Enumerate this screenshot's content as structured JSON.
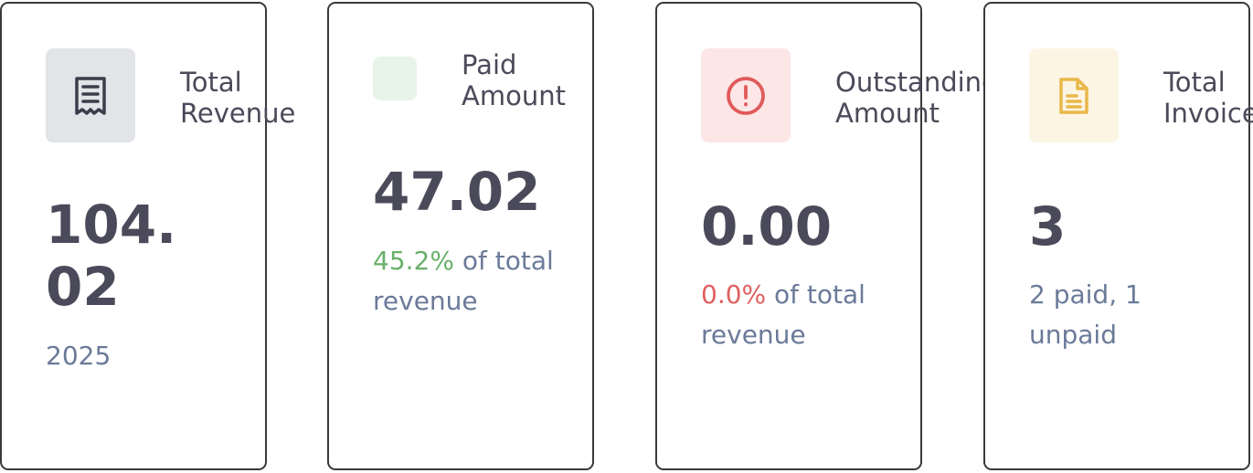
{
  "cards": [
    {
      "title": "Total\nRevenue",
      "value": "104.02",
      "sub": "2025",
      "icon": "receipt-icon",
      "icon_bg": "#e2e4e8",
      "icon_color": "#3a3e4a"
    },
    {
      "title": "Paid\nAmount",
      "value": "47.02",
      "sub_pct": "45.2%",
      "sub_text": " of total revenue",
      "icon": "check-icon",
      "icon_bg": "#e8f4e8",
      "pct_color": "#6ab06a"
    },
    {
      "title": "Outstanding\nAmount",
      "value": "0.00",
      "sub_pct": "0.0%",
      "sub_text": " of total revenue",
      "icon": "alert-circle-icon",
      "icon_bg": "#fce6e6",
      "icon_color": "#e05a5a",
      "pct_color": "#e06060"
    },
    {
      "title": "Total\nInvoices",
      "value": "3",
      "sub": "2 paid, 1 unpaid",
      "icon": "file-text-icon",
      "icon_bg": "#fdf5e4",
      "icon_color": "#e8b84a"
    }
  ],
  "colors": {
    "border": "#3a3a3a",
    "text_dark": "#4a4a5a",
    "text_muted": "#6b7a99"
  }
}
